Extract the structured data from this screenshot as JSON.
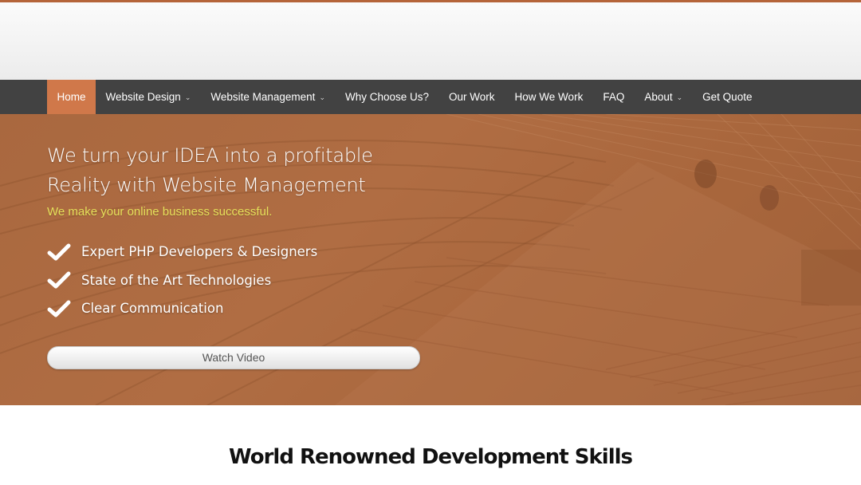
{
  "nav": {
    "items": [
      {
        "label": "Home",
        "active": true,
        "dropdown": false
      },
      {
        "label": "Website Design",
        "active": false,
        "dropdown": true
      },
      {
        "label": "Website Management",
        "active": false,
        "dropdown": true
      },
      {
        "label": "Why Choose Us?",
        "active": false,
        "dropdown": false
      },
      {
        "label": "Our Work",
        "active": false,
        "dropdown": false
      },
      {
        "label": "How We Work",
        "active": false,
        "dropdown": false
      },
      {
        "label": "FAQ",
        "active": false,
        "dropdown": false
      },
      {
        "label": "About",
        "active": false,
        "dropdown": true
      },
      {
        "label": "Get Quote",
        "active": false,
        "dropdown": false
      }
    ]
  },
  "hero": {
    "title_line1": "We turn your IDEA into a profitable",
    "title_line2": "Reality with Website Management",
    "subtitle": "We make your online business successful.",
    "features": [
      "Expert PHP Developers & Designers",
      "State of the Art Technologies",
      "Clear Communication"
    ],
    "watch_button_label": "Watch Video"
  },
  "section": {
    "title": "World Renowned Development Skills"
  },
  "colors": {
    "accent": "#d0784a",
    "navbar": "#424242",
    "hero_overlay": "#a9683f",
    "subtitle": "#e6e05a"
  },
  "icons": {
    "check": "check-icon",
    "caret": "chevron-down-icon"
  }
}
